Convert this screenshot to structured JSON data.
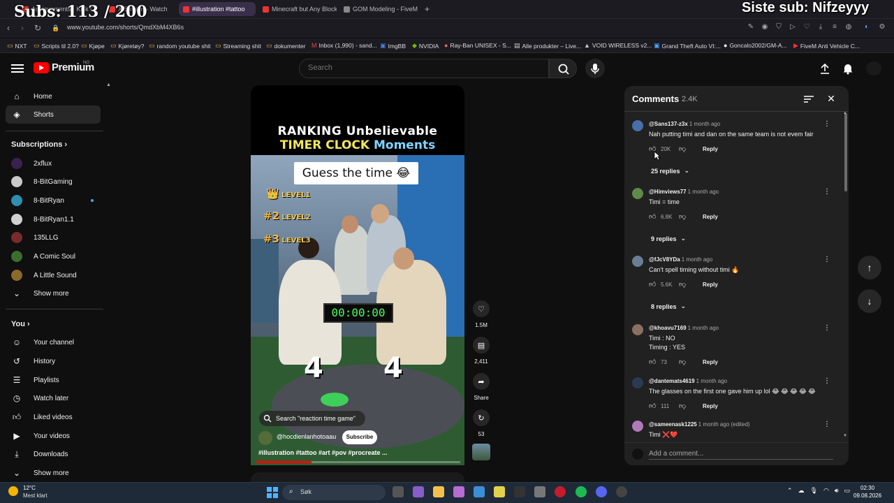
{
  "overlay": {
    "subs": "Subs: 113 / 200",
    "last_sub": "Siste sub: Nifzeyyy"
  },
  "browser": {
    "tabs": [
      {
        "label": "Achievements - Kick Gosh"
      },
      {
        "label": "X Stream - Watch"
      },
      {
        "label": "#illustration #tattoo"
      },
      {
        "label": "Minecraft but Any Block is"
      },
      {
        "label": "GOM Modeling - FiveM &"
      }
    ],
    "url": "www.youtube.com/shorts/QmdXbM4XB6s",
    "bookmarks": [
      "NXT",
      "Scripts til 2.0?",
      "Kjøpe",
      "Kjøretøy?",
      "random youtube shit",
      "Streaming shit",
      "dokumenter",
      "Inbox (1,990) - sand...",
      "ImgBB",
      "NVIDIA",
      "Ray-Ban UNISEX - S...",
      "Alle produkter – Live...",
      "VOID WIRELESS v2...",
      "Grand Theft Auto VI:...",
      "Goncalo2002/GM-A...",
      "FiveM Anti Vehicle C..."
    ]
  },
  "header": {
    "logo_text": "Premium",
    "logo_country": "NO",
    "search_placeholder": "Search"
  },
  "sidebar": {
    "main": [
      {
        "label": "Home",
        "icon": "home-icon"
      },
      {
        "label": "Shorts",
        "icon": "shorts-icon"
      }
    ],
    "subscriptions_title": "Subscriptions",
    "subscriptions": [
      {
        "label": "2xflux",
        "color": "#3a2250"
      },
      {
        "label": "8-BitGaming",
        "color": "#c9c9c9"
      },
      {
        "label": "8-BitRyan",
        "color": "#2e8fb0"
      },
      {
        "label": "8-BitRyan1.1",
        "color": "#d0d0d0"
      },
      {
        "label": "135LLG",
        "color": "#7a2a2a"
      },
      {
        "label": "A Comic Soul",
        "color": "#3b6e2e"
      },
      {
        "label": "A Little Sound",
        "color": "#8a6a2a"
      }
    ],
    "show_more": "Show more",
    "you_title": "You",
    "you_items": [
      {
        "label": "Your channel"
      },
      {
        "label": "History"
      },
      {
        "label": "Playlists"
      },
      {
        "label": "Watch later"
      },
      {
        "label": "Liked videos"
      },
      {
        "label": "Your videos"
      },
      {
        "label": "Downloads"
      }
    ],
    "show_more_2": "Show more"
  },
  "video": {
    "title_line1": "RANKING Unbelievable",
    "title_line2_a": "TIMER CLOCK",
    "title_line2_b": "Moments",
    "guess": "Guess the time 😂",
    "levels": [
      {
        "rank": "👑",
        "label": "LEVEL1"
      },
      {
        "rank": "#2",
        "label": "LEVEL2"
      },
      {
        "rank": "#3",
        "label": "LEVEL3"
      }
    ],
    "timer": "00:00:00",
    "left_number": "4",
    "right_number": "4",
    "search_suggestion": "Search \"reaction time game\"",
    "channel": "@hocdienlanhotoaau",
    "subscribe": "Subscribe",
    "tags": "#illustration #tattoo #art #pov #procreate ...",
    "progress": 0.27
  },
  "actions": {
    "likes": "1.5M",
    "comments": "2,411",
    "share": "Share",
    "remix": "53"
  },
  "comments": {
    "title": "Comments",
    "count": "2.4K",
    "items": [
      {
        "user": "@Sans137-z3x",
        "time": "1 month ago",
        "text": "Nah putting timi and dan on the same team is not evem fair",
        "likes": "20K",
        "reply": "Reply",
        "replies": "25 replies",
        "avatar": "#4b6ea8"
      },
      {
        "user": "@Himviews77",
        "time": "1 month ago",
        "text": "Timi = time",
        "likes": "6.8K",
        "reply": "Reply",
        "replies": "9 replies",
        "avatar": "#5f8a4b"
      },
      {
        "user": "@fJcV8YDa",
        "time": "1 month ago",
        "text": "Can't spell timing without timi 🔥",
        "likes": "5.6K",
        "reply": "Reply",
        "replies": "8 replies",
        "avatar": "#6a7f95"
      },
      {
        "user": "@khoavu7169",
        "time": "1 month ago",
        "text": "Timi : NO\nTiming : YES",
        "likes": "73",
        "reply": "Reply",
        "avatar": "#8a7060"
      },
      {
        "user": "@dantemats4619",
        "time": "1 month ago",
        "text": "The glasses on the first one gave him up lol 😂 😂 😂 😂 😂",
        "likes": "111",
        "reply": "Reply",
        "avatar": "#2a3a55"
      },
      {
        "user": "@sameenask1225",
        "time": "1 month ago (edited)",
        "text": "Timi ❌❤️",
        "avatar": "#b07ab8"
      }
    ],
    "add_placeholder": "Add a comment..."
  },
  "taskbar": {
    "temp": "12°C",
    "weather": "Mest klart",
    "search": "Søk",
    "time": "02:30",
    "date": "09.08.2026"
  }
}
